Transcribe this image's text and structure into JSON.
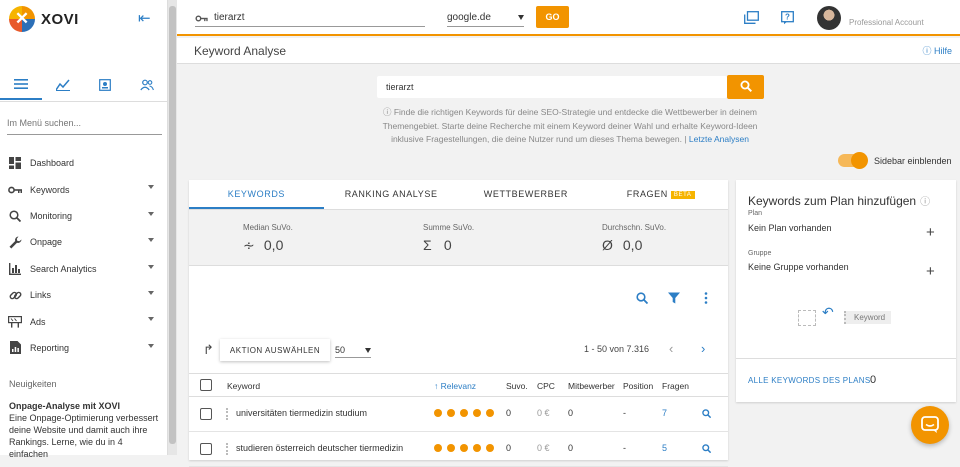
{
  "brand": {
    "name": "XOVI",
    "accent": "#f29400",
    "link": "#2c7ec5"
  },
  "sidebar": {
    "search_placeholder": "Im Menü suchen...",
    "tab_icons": [
      "list-icon",
      "chart-icon",
      "contact-icon",
      "users-icon"
    ],
    "items": [
      {
        "label": "Dashboard",
        "icon": "dashboard-icon",
        "expandable": false
      },
      {
        "label": "Keywords",
        "icon": "key-icon",
        "expandable": true
      },
      {
        "label": "Monitoring",
        "icon": "search-icon",
        "expandable": true
      },
      {
        "label": "Onpage",
        "icon": "wrench-icon",
        "expandable": true
      },
      {
        "label": "Search Analytics",
        "icon": "bar-chart-icon",
        "expandable": true
      },
      {
        "label": "Links",
        "icon": "link-icon",
        "expandable": true
      },
      {
        "label": "Ads",
        "icon": "ads-icon",
        "expandable": true
      },
      {
        "label": "Reporting",
        "icon": "report-icon",
        "expandable": true
      }
    ],
    "news": {
      "heading": "Neuigkeiten",
      "title": "Onpage-Analyse mit XOVI",
      "text": "Eine Onpage-Optimierung verbessert deine Website und damit auch ihre Rankings. Lerne, wie du in 4 einfachen"
    }
  },
  "topbar": {
    "keyword_value": "tierarzt",
    "engine": "google.de",
    "go_label": "GO",
    "account_label": "Professional Account"
  },
  "page": {
    "title": "Keyword Analyse",
    "help_label": "Hilfe",
    "search_value": "tierarzt",
    "info_text": "ⓘ Finde die richtigen Keywords für deine SEO-Strategie und entdecke die Wettbewerber in deinem Themengebiet. Starte deine Recherche mit einem Keyword deiner Wahl und erhalte Keyword-Ideen inklusive Fragestellungen, die deine Nutzer rund um dieses Thema bewegen. |",
    "last_analyses_label": "Letzte Analysen",
    "sidebar_toggle_label": "Sidebar einblenden"
  },
  "tabs": [
    {
      "label": "KEYWORDS",
      "active": true
    },
    {
      "label": "RANKING ANALYSE",
      "active": false
    },
    {
      "label": "WETTBEWERBER",
      "active": false
    },
    {
      "label": "FRAGEN",
      "active": false,
      "badge": "BETA"
    }
  ],
  "stats": [
    {
      "label": "Median SuVo.",
      "symbol": "∻",
      "value": "0,0"
    },
    {
      "label": "Summe SuVo.",
      "symbol": "Σ",
      "value": "0"
    },
    {
      "label": "Durchschn. SuVo.",
      "symbol": "Ø",
      "value": "0,0"
    }
  ],
  "table": {
    "action_label": "AKTION AUSWÄHLEN",
    "per_page": "50",
    "pagination_text": "1 - 50 von 7.316",
    "headers": {
      "keyword": "Keyword",
      "relevance": "↑ Relevanz",
      "suvo": "Suvo.",
      "cpc": "CPC",
      "competitors": "Mitbewerber",
      "position": "Position",
      "questions": "Fragen"
    },
    "rows": [
      {
        "keyword": "universitäten tiermedizin studium",
        "relevance": 5,
        "suvo": "0",
        "cpc": "0 €",
        "competitors": "0",
        "position": "-",
        "questions": "7"
      },
      {
        "keyword": "studieren österreich deutscher tiermedizin",
        "relevance": 5,
        "suvo": "0",
        "cpc": "0 €",
        "competitors": "0",
        "position": "-",
        "questions": "5"
      }
    ]
  },
  "plan_panel": {
    "title": "Keywords zum Plan hinzufügen",
    "plan_label": "Plan",
    "plan_value": "Kein Plan vorhanden",
    "group_label": "Gruppe",
    "group_value": "Keine Gruppe vorhanden",
    "drop_keyword_label": "Keyword",
    "all_keywords_label": "ALLE KEYWORDS DES PLANS",
    "all_keywords_count": "0"
  }
}
